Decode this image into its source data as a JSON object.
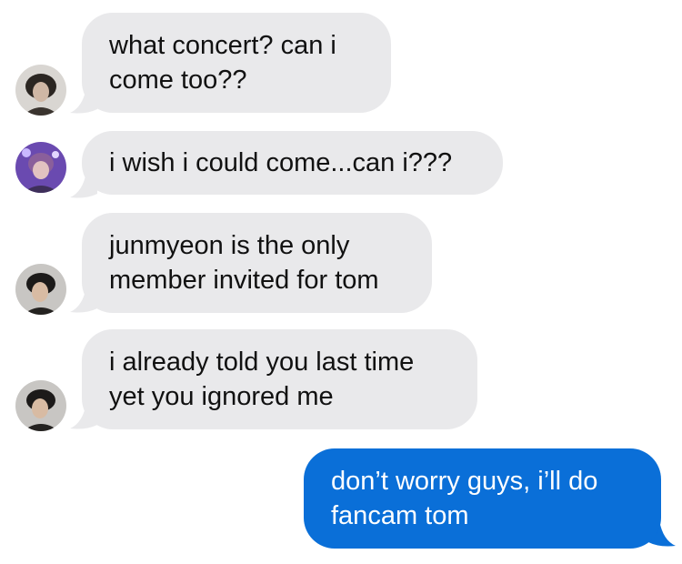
{
  "colors": {
    "incoming_bubble": "#e9e9eb",
    "outgoing_bubble": "#0a6fd8",
    "incoming_text": "#111111",
    "outgoing_text": "#ffffff"
  },
  "messages": [
    {
      "direction": "incoming",
      "avatar": "avatar-1",
      "lines": [
        "what concert? can i",
        "come too??"
      ]
    },
    {
      "direction": "incoming",
      "avatar": "avatar-2",
      "lines": [
        "i wish i could come...can i???"
      ]
    },
    {
      "direction": "incoming",
      "avatar": "avatar-3",
      "lines": [
        "junmyeon is the only",
        "member invited for tom"
      ]
    },
    {
      "direction": "incoming",
      "avatar": "avatar-3",
      "lines": [
        "i already told you last time",
        "yet you ignored me"
      ]
    },
    {
      "direction": "outgoing",
      "lines": [
        "don’t worry guys, i’ll do",
        "fancam tom"
      ]
    }
  ]
}
